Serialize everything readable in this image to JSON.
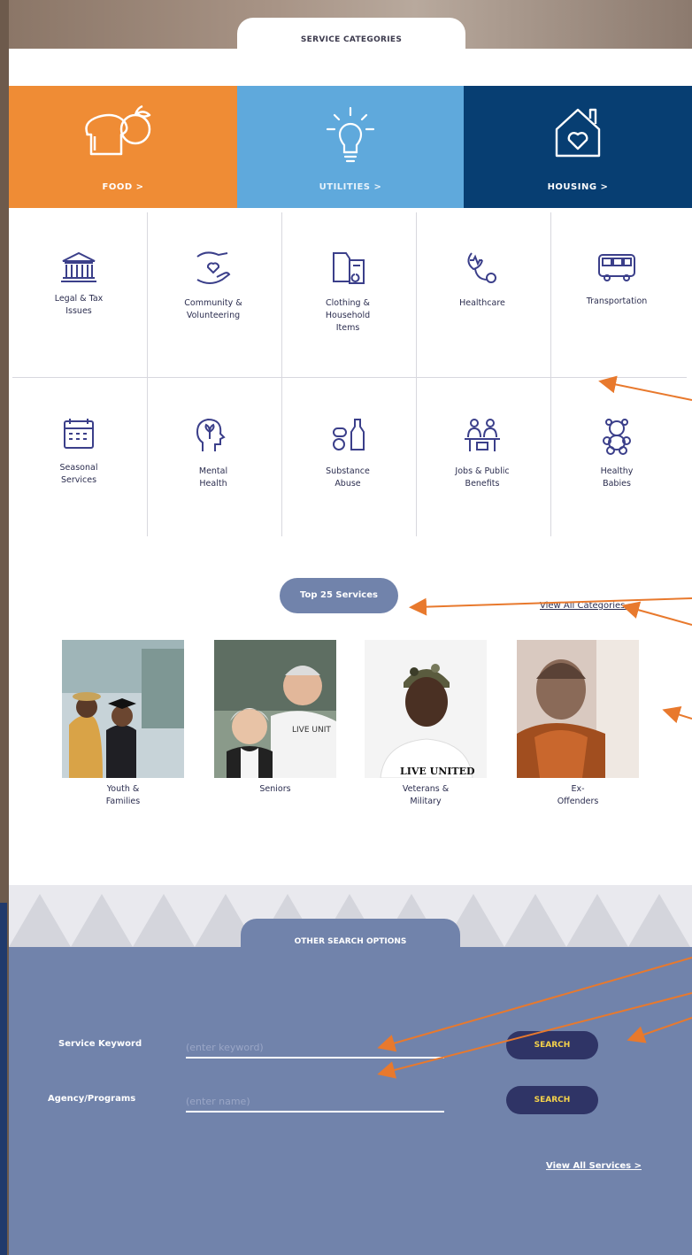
{
  "service_categories_tab": "SERVICE CATEGORIES",
  "featured": [
    {
      "label": "FOOD  >",
      "icon": "bread-apple-icon"
    },
    {
      "label": "UTILITIES  >",
      "icon": "lightbulb-icon"
    },
    {
      "label": "HOUSING  >",
      "icon": "house-heart-icon"
    }
  ],
  "categories_row1": [
    {
      "label": "Legal & Tax\nIssues",
      "icon": "courthouse-icon"
    },
    {
      "label": "Community &\nVolunteering",
      "icon": "hands-heart-icon"
    },
    {
      "label": "Clothing &\nHousehold\nItems",
      "icon": "clothing-icon"
    },
    {
      "label": "Healthcare",
      "icon": "stethoscope-icon"
    },
    {
      "label": "Transportation",
      "icon": "bus-icon"
    }
  ],
  "categories_row2": [
    {
      "label": "Seasonal\nServices",
      "icon": "calendar-icon"
    },
    {
      "label": "Mental\nHealth",
      "icon": "head-flower-icon"
    },
    {
      "label": "Substance\nAbuse",
      "icon": "pills-bottle-icon"
    },
    {
      "label": "Jobs & Public\nBenefits",
      "icon": "people-desk-icon"
    },
    {
      "label": "Healthy\nBabies",
      "icon": "teddy-bear-icon"
    }
  ],
  "top_services_button": "Top 25 Services",
  "view_all_categories": "View All Categories",
  "view_all_categories_chevron": "›",
  "audiences": [
    {
      "label": "Youth &\nFamilies"
    },
    {
      "label": "Seniors"
    },
    {
      "label": "Veterans &\nMilitary"
    },
    {
      "label": "Ex-\nOffenders"
    }
  ],
  "photo_text": {
    "seniors_shirt": "LIVE UNIT",
    "veteran_shirt": "LIVE UNITED"
  },
  "other_search_tab": "OTHER SEARCH OPTIONS",
  "keyword": {
    "label": "Service Keyword",
    "placeholder": "(enter keyword)",
    "button": "SEARCH"
  },
  "agency": {
    "label": "Agency/Programs",
    "placeholder": "(enter name)",
    "button": "SEARCH"
  },
  "view_all_services": "View All Services >",
  "colors": {
    "food": "#ef8c35",
    "utilities": "#5fa9dc",
    "housing": "#073e72",
    "panel": "#7183ab",
    "arrow": "#e8792d",
    "button": "#2f3466"
  }
}
